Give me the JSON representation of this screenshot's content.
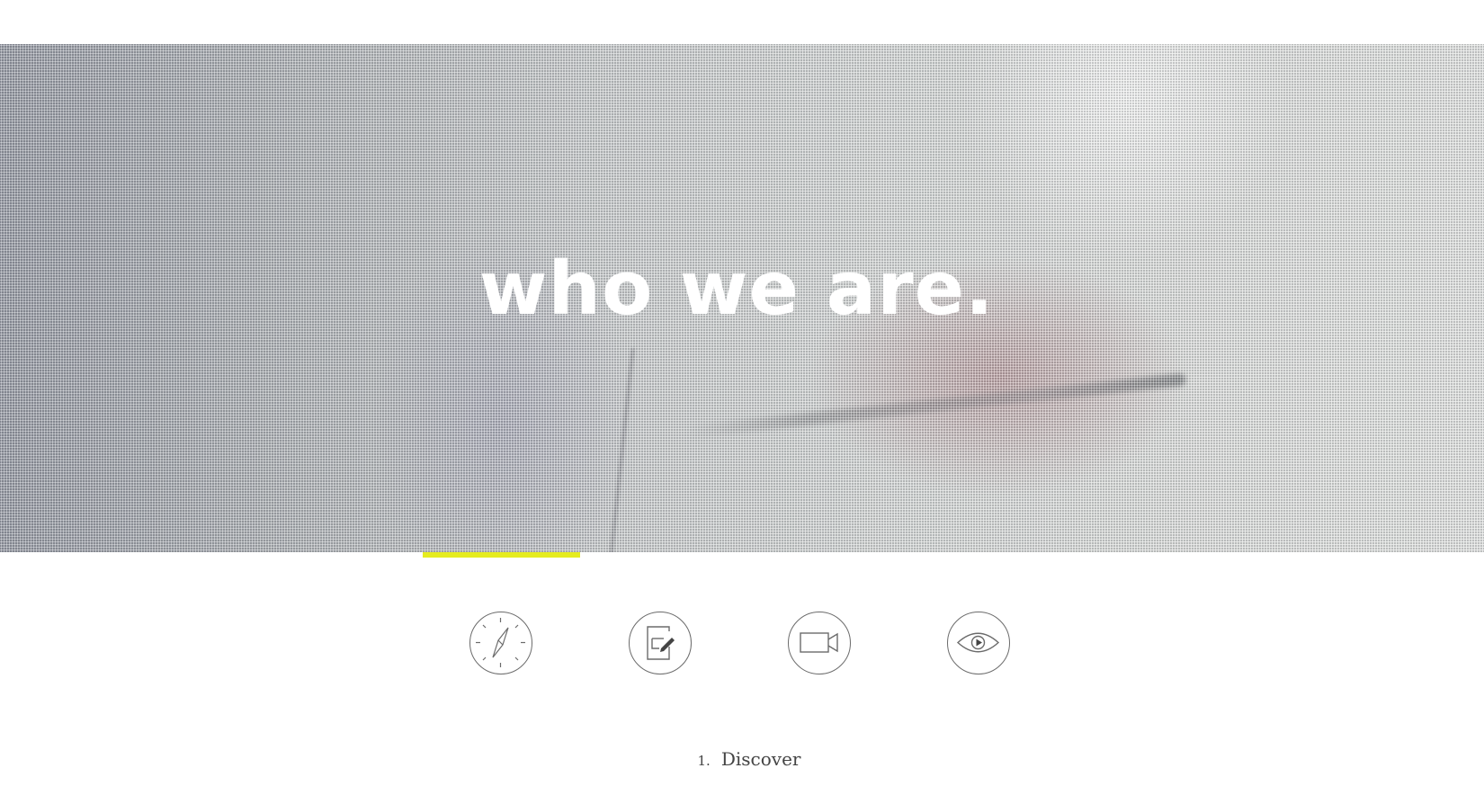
{
  "hero": {
    "title": "who we are."
  },
  "steps": {
    "items": [
      {
        "icon": "compass-icon"
      },
      {
        "icon": "edit-document-icon"
      },
      {
        "icon": "video-camera-icon"
      },
      {
        "icon": "eye-icon"
      }
    ],
    "active_index": 0,
    "active_number": "1.",
    "active_label": "Discover"
  },
  "colors": {
    "accent": "#e5ec1f",
    "icon_stroke": "#6b6b6b",
    "text": "#444444"
  }
}
